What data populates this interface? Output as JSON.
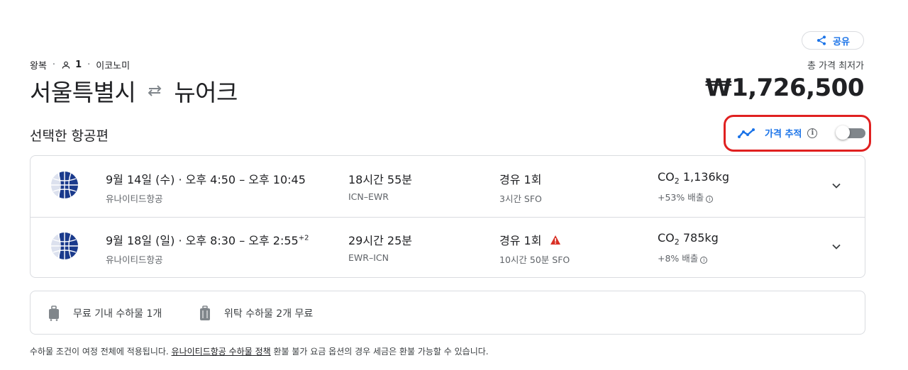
{
  "share": {
    "label": "공유",
    "icon": "share-icon"
  },
  "trip": {
    "type": "왕복",
    "passengers": "1",
    "cabin": "이코노미",
    "origin": "서울특별시",
    "destination": "뉴어크"
  },
  "price": {
    "label": "총 가격 최저가",
    "value": "₩1,726,500"
  },
  "section_title": "선택한 항공편",
  "price_tracking": {
    "label": "가격 추적",
    "enabled": false,
    "highlight_color": "#e02020"
  },
  "flights": [
    {
      "date": "9월 14일 (수)",
      "dep": "오후 4:50",
      "arr": "오후 10:45",
      "arr_offset": "",
      "airline": "유나이티드항공",
      "duration": "18시간 55분",
      "route": "ICN–EWR",
      "stops": "경유 1회",
      "layover": "3시간 SFO",
      "warning": false,
      "co2": "1,136kg",
      "emissions": "+53% 배출"
    },
    {
      "date": "9월 18일 (일)",
      "dep": "오후 8:30",
      "arr": "오후 2:55",
      "arr_offset": "+2",
      "airline": "유나이티드항공",
      "duration": "29시간 25분",
      "route": "EWR–ICN",
      "stops": "경유 1회",
      "layover": "10시간 50분 SFO",
      "warning": true,
      "co2": "785kg",
      "emissions": "+8% 배출"
    }
  ],
  "bags": {
    "carry_on": "무료 기내 수하물 1개",
    "checked": "위탁 수하물 2개 무료"
  },
  "footnote": {
    "before": "수하물 조건이 여정 전체에 적용됩니다.",
    "link": "유나이티드항공 수하물 정책",
    "after": " 환불 불가 요금 옵션의 경우 세금은 환불 가능할 수 있습니다."
  },
  "colors": {
    "accent": "#1a73e8",
    "warning": "#d93025",
    "airline_logo": "#1a3a8c"
  }
}
